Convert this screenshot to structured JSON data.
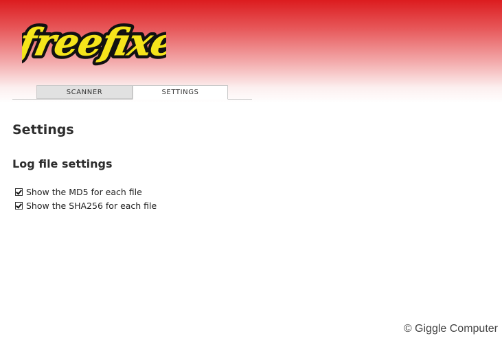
{
  "app": {
    "logo_text": "freefixer",
    "logo_colors": {
      "fill": "#f5e41b",
      "outline": "#111111"
    },
    "header_color": "#dc1c1f"
  },
  "tabs": [
    {
      "label": "SCANNER",
      "active": false
    },
    {
      "label": "SETTINGS",
      "active": true
    }
  ],
  "page": {
    "title": "Settings",
    "section_title": "Log file settings",
    "options": [
      {
        "label": "Show the MD5 for each file",
        "checked": true
      },
      {
        "label": "Show the SHA256 for each file",
        "checked": true
      }
    ]
  },
  "watermark": "© Giggle Computer"
}
